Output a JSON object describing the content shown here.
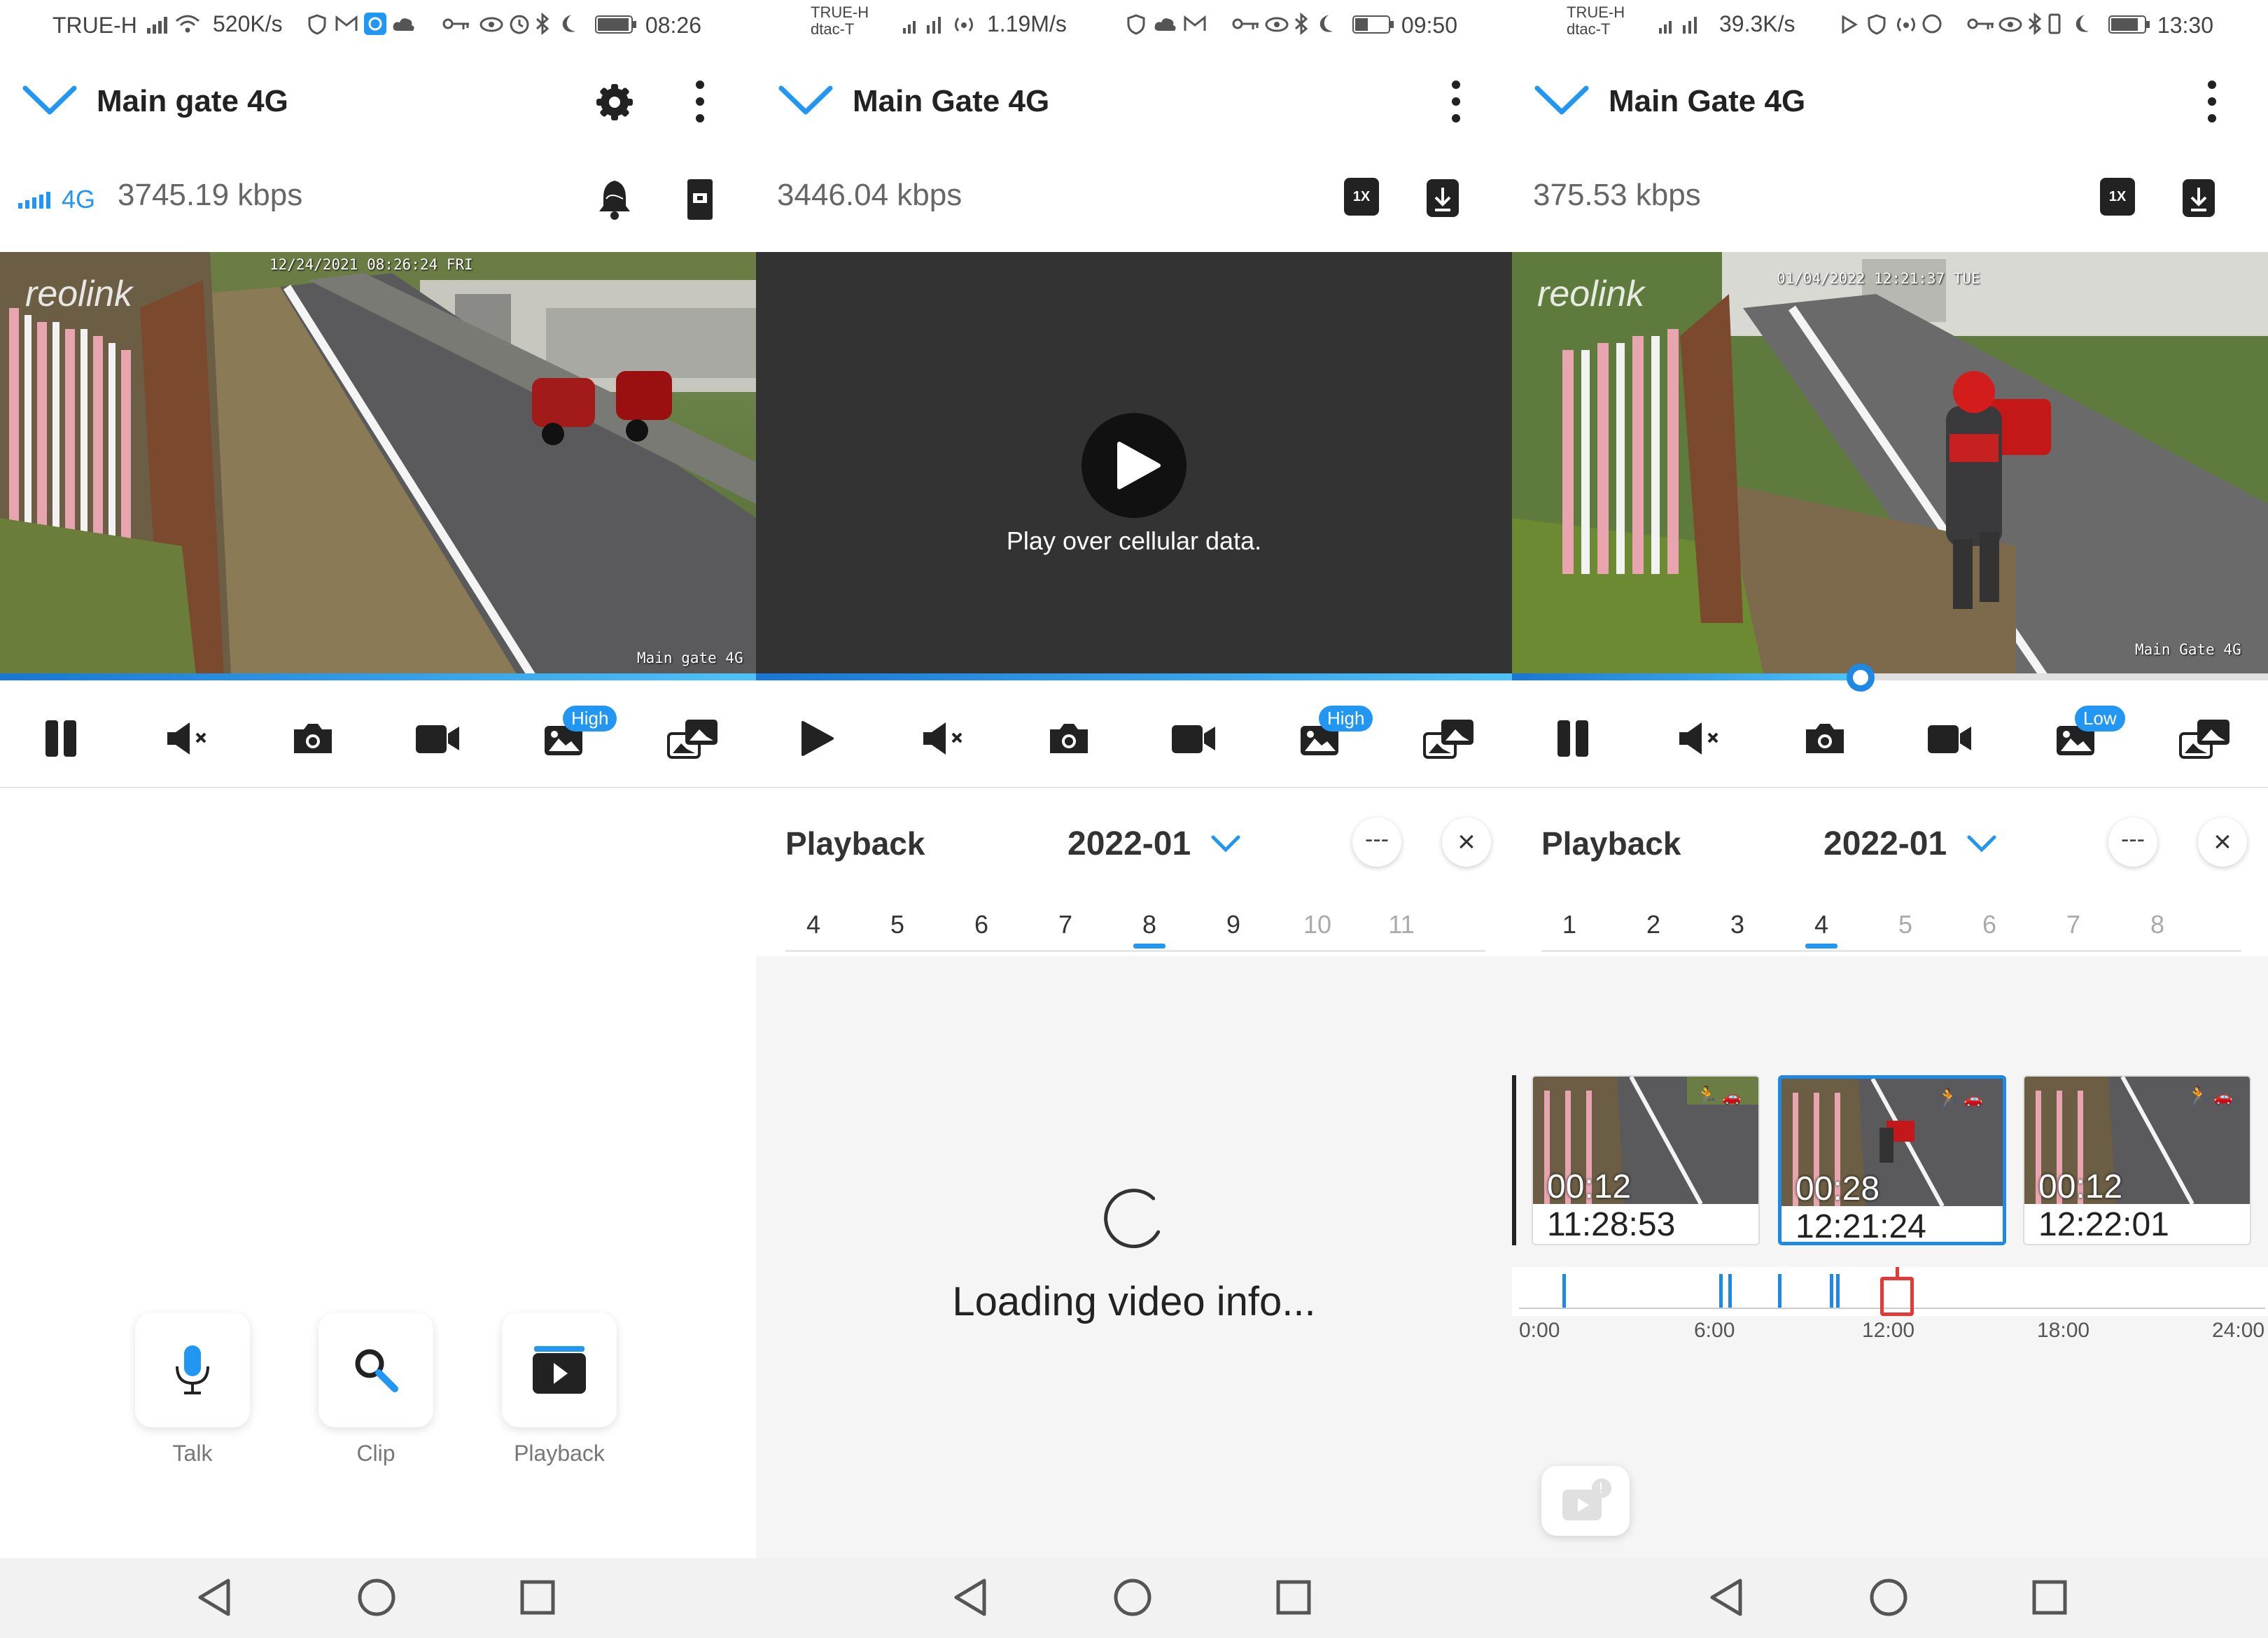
{
  "colors": {
    "accent": "#2196f3",
    "playback_marker": "#e53935",
    "video_dark": "#333333"
  },
  "panels": [
    {
      "status": {
        "carrier": "TRUE-H",
        "net_speed": "520K/s",
        "time": "08:26"
      },
      "header": {
        "title": "Main gate 4G"
      },
      "stream": {
        "signal": "4G",
        "bitrate": "3745.19 kbps"
      },
      "video": {
        "timestamp": "12/24/2021 08:26:24 FRI",
        "brand": "reolink",
        "camera_name": "Main gate 4G",
        "progress": 1.0
      },
      "controls": {
        "quality_badge": "High"
      },
      "actions": [
        {
          "label": "Talk",
          "icon": "microphone-icon"
        },
        {
          "label": "Clip",
          "icon": "search-icon"
        },
        {
          "label": "Playback",
          "icon": "playback-icon"
        }
      ]
    },
    {
      "status": {
        "carrier1": "TRUE-H",
        "carrier2": "dtac-T",
        "net_speed": "1.19M/s",
        "time": "09:50"
      },
      "header": {
        "title": "Main Gate 4G"
      },
      "stream": {
        "bitrate": "3446.04 kbps",
        "speed_label": "1X"
      },
      "video": {
        "overlay_text": "Play over cellular data.",
        "progress": 1.0
      },
      "controls": {
        "quality_badge": "High"
      },
      "playback": {
        "title": "Playback",
        "month": "2022-01",
        "more": "---",
        "days": [
          "4",
          "5",
          "6",
          "7",
          "8",
          "9",
          "10",
          "11"
        ],
        "selected_day": "8",
        "loading": "Loading video info..."
      }
    },
    {
      "status": {
        "carrier1": "TRUE-H",
        "carrier2": "dtac-T",
        "net_speed": "39.3K/s",
        "time": "13:30"
      },
      "header": {
        "title": "Main Gate 4G"
      },
      "stream": {
        "bitrate": "375.53 kbps",
        "speed_label": "1X"
      },
      "video": {
        "timestamp": "01/04/2022 12:21:37 TUE",
        "brand": "reolink",
        "camera_name": "Main Gate 4G",
        "progress": 0.46
      },
      "controls": {
        "quality_badge": "Low"
      },
      "playback": {
        "title": "Playback",
        "month": "2022-01",
        "more": "---",
        "days": [
          "1",
          "2",
          "3",
          "4",
          "5",
          "6",
          "7",
          "8"
        ],
        "selected_day": "4",
        "clips": [
          {
            "duration": "00:12",
            "time": "11:28:53"
          },
          {
            "duration": "00:28",
            "time": "12:21:24"
          },
          {
            "duration": "00:12",
            "time": "12:22:01"
          }
        ],
        "timeline_labels": [
          "0:00",
          "6:00",
          "12:00",
          "18:00",
          "24:00"
        ],
        "timeline_events_hours": [
          1.4,
          6.5,
          6.8,
          8.4,
          10.1,
          10.3
        ]
      }
    }
  ]
}
